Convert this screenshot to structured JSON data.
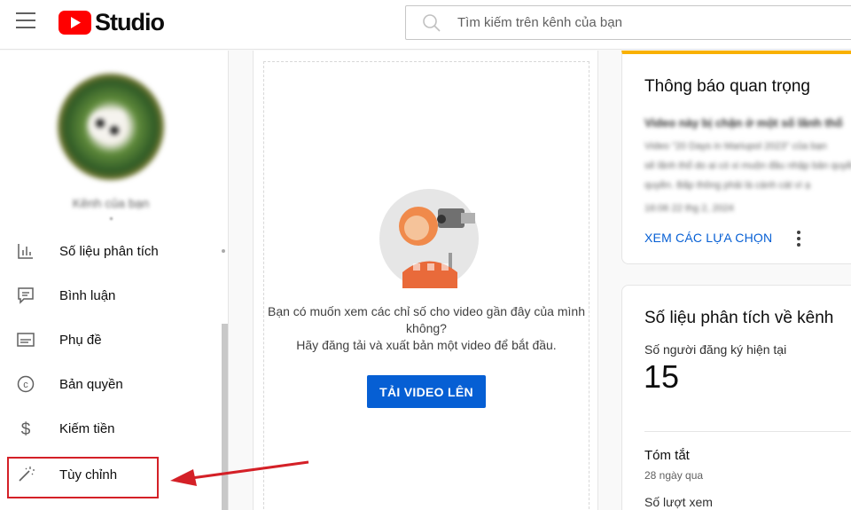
{
  "header": {
    "app_name": "Studio",
    "search_placeholder": "Tìm kiếm trên kênh của bạn"
  },
  "sidebar": {
    "channel_name": "Kênh của bạn",
    "items": [
      {
        "label": "Số liệu phân tích",
        "icon": "analytics-icon"
      },
      {
        "label": "Bình luận",
        "icon": "comments-icon"
      },
      {
        "label": "Phụ đề",
        "icon": "subtitles-icon"
      },
      {
        "label": "Bản quyền",
        "icon": "copyright-icon"
      },
      {
        "label": "Kiếm tiền",
        "icon": "dollar-icon"
      },
      {
        "label": "Tùy chỉnh",
        "icon": "magic-wand-icon"
      }
    ]
  },
  "main": {
    "prompt_line1": "Bạn có muốn xem các chỉ số cho video gần đây của mình",
    "prompt_line2": "không?",
    "prompt_line3": "Hãy đăng tải và xuất bản một video để bắt đầu.",
    "upload_button": "TẢI VIDEO LÊN"
  },
  "notice_card": {
    "title": "Thông báo quan trọng",
    "blurred_line1": "Video này bị chặn ở một số lãnh thổ",
    "blurred_line2": "Video \"20 Days in Mariupol 2023\" của bạn",
    "blurred_line3": "sẽ lãnh thổ do ai có xi muộn đâu nhập bản quyền",
    "blurred_line4": "quyền. Bấp thông phải là cánh cát vì ạ",
    "blurred_date": "16:06 22 thg 2, 2024",
    "action_link": "XEM CÁC LỰA CHỌN"
  },
  "analytics_card": {
    "title": "Số liệu phân tích về kênh",
    "subscribers_label": "Số người đăng ký hiện tại",
    "subscribers_value": "15",
    "summary_title": "Tóm tắt",
    "summary_period": "28 ngày qua",
    "views_label": "Số lượt xem"
  },
  "colors": {
    "brand_red": "#ff0000",
    "primary_blue": "#065fd4",
    "notice_accent": "#f9b100",
    "annotation_red": "#d42027"
  }
}
